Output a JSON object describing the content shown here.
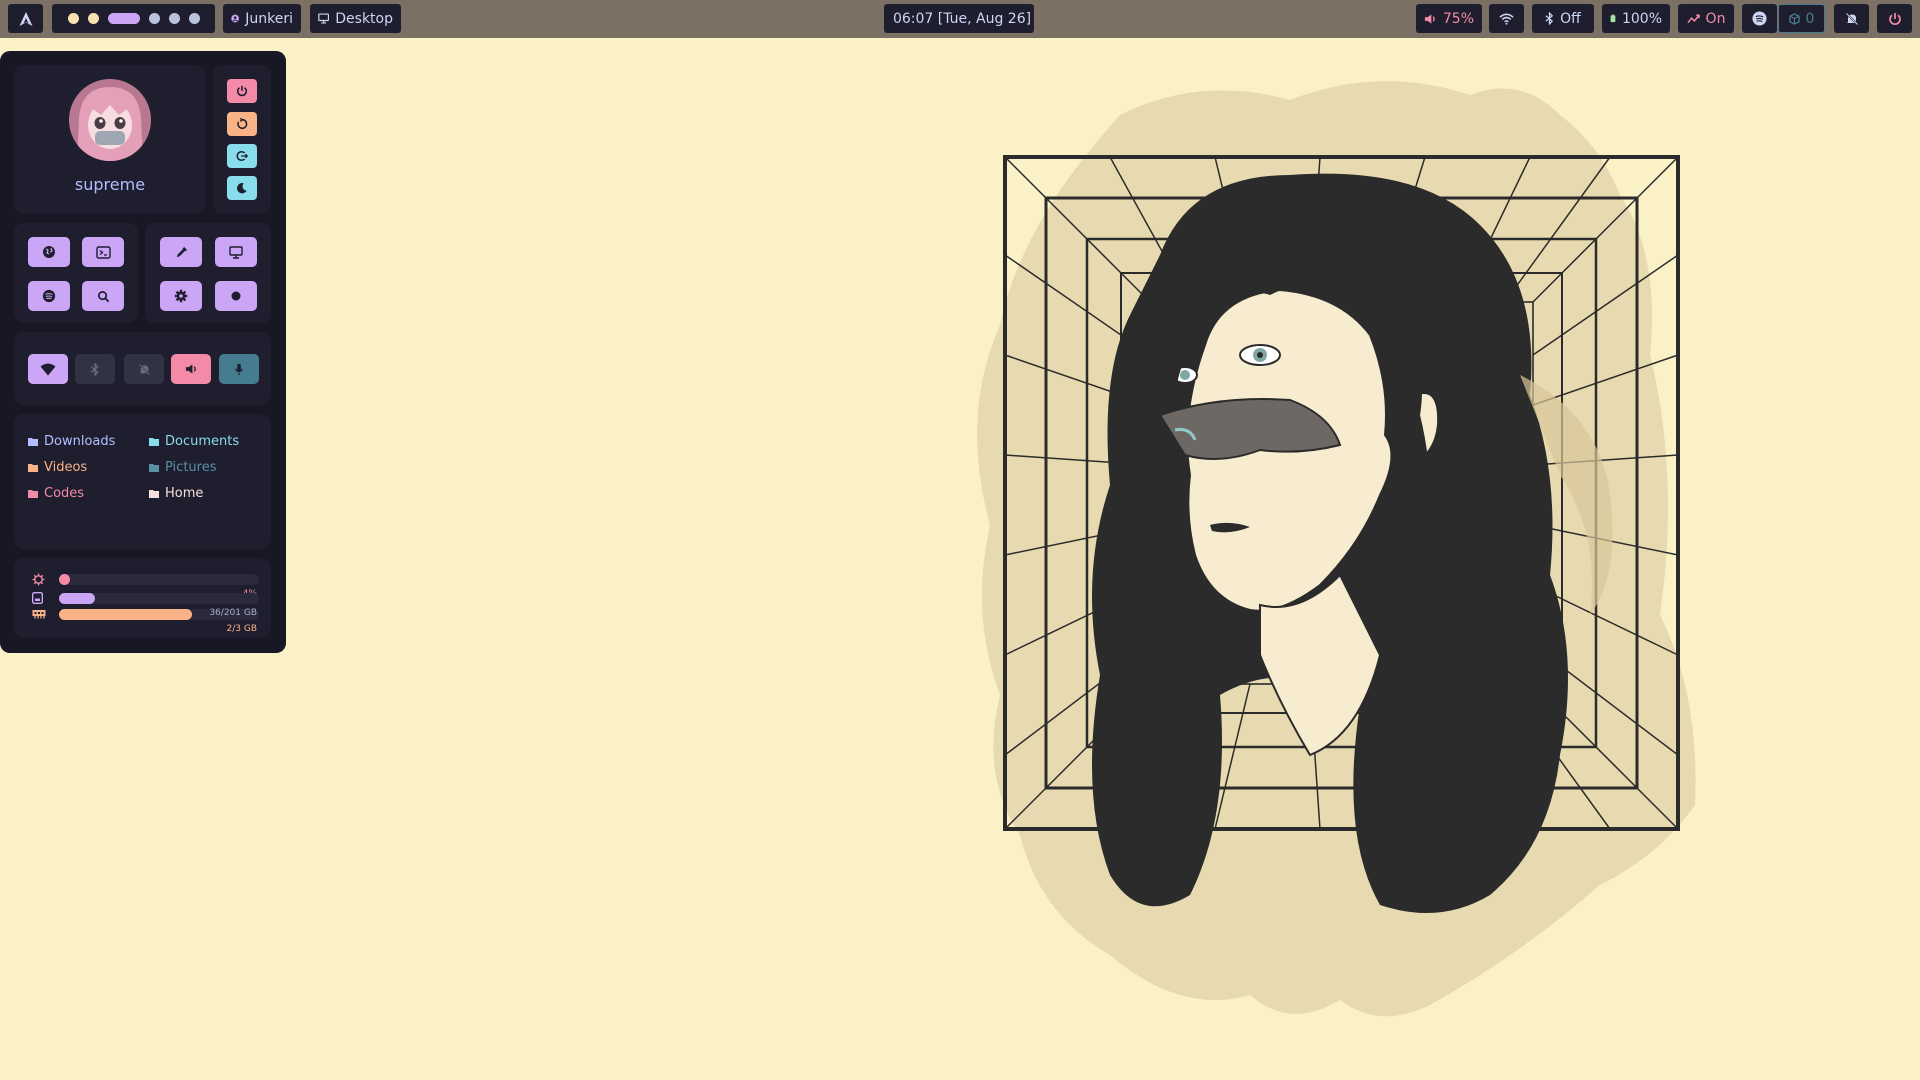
{
  "topbar": {
    "launcher_icon": "arch-logo-icon",
    "workspaces": [
      {
        "state": "occupied",
        "color": "#f9e2af"
      },
      {
        "state": "occupied",
        "color": "#f9e2af"
      },
      {
        "state": "active",
        "color": "#cba6f7"
      },
      {
        "state": "empty",
        "color": "#bac2de"
      },
      {
        "state": "empty",
        "color": "#bac2de"
      },
      {
        "state": "empty",
        "color": "#bac2de"
      }
    ],
    "user_label": "Junkeri",
    "window_label": "Desktop",
    "clock": "06:07 [Tue, Aug 26]",
    "volume": "75%",
    "bluetooth": "Off",
    "battery": "100%",
    "network_status": "On",
    "updates_count": "0"
  },
  "dashboard": {
    "username": "supreme",
    "power_buttons": [
      {
        "name": "power-button",
        "icon": "power-icon",
        "color": "#f38ba8"
      },
      {
        "name": "reboot-button",
        "icon": "reboot-icon",
        "color": "#fab387"
      },
      {
        "name": "logout-button",
        "icon": "logout-icon",
        "color": "#89dceb"
      },
      {
        "name": "sleep-button",
        "icon": "moon-icon",
        "color": "#89dceb"
      }
    ],
    "apps": [
      "browser-icon",
      "terminal-icon",
      "spotify-icon",
      "search-icon",
      "picker-icon",
      "display-icon",
      "gear-icon",
      "record-icon"
    ],
    "toggles": [
      {
        "name": "wifi-toggle",
        "icon": "wifi-icon",
        "on": true,
        "color": "#cba6f7"
      },
      {
        "name": "bluetooth-toggle",
        "icon": "bluetooth-icon",
        "on": false,
        "color": "#313244"
      },
      {
        "name": "notifications-toggle",
        "icon": "bell-off-icon",
        "on": false,
        "color": "#313244"
      },
      {
        "name": "volume-toggle",
        "icon": "volume-icon",
        "on": true,
        "color": "#f38ba8"
      },
      {
        "name": "mic-toggle",
        "icon": "mic-icon",
        "on": true,
        "color": "#457c8f"
      }
    ],
    "folders": [
      {
        "label": "Downloads",
        "color": "#b4befe"
      },
      {
        "label": "Documents",
        "color": "#89dceb"
      },
      {
        "label": "Videos",
        "color": "#fab387"
      },
      {
        "label": "Pictures",
        "color": "#5a8fa8"
      },
      {
        "label": "Codes",
        "color": "#f38ba8"
      },
      {
        "label": "Home",
        "color": "#f5e0dc"
      }
    ],
    "meters": [
      {
        "name": "cpu",
        "icon": "cpu-icon",
        "fraction": 0.04,
        "label": "4%",
        "color": "#f38ba8"
      },
      {
        "name": "ram",
        "icon": "memory-icon",
        "fraction": 0.667,
        "label": "2/3 GB",
        "color": "#fab387"
      },
      {
        "name": "disk",
        "icon": "disk-icon",
        "fraction": 0.18,
        "label": "36/201 GB",
        "color": "#cba6f7"
      }
    ]
  },
  "colors": {
    "desktop_bg": "#fbf1c7",
    "bar_bg": "#7c6f64",
    "panel_bg": "#181825",
    "card_bg": "#1e1e2e",
    "accent": "#cba6f7"
  }
}
